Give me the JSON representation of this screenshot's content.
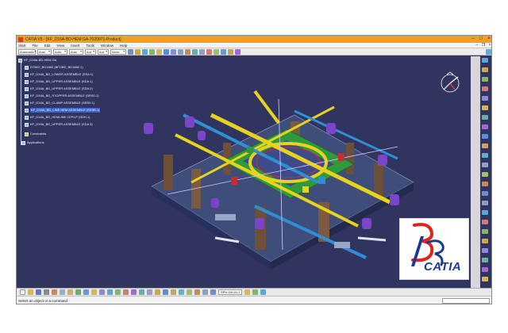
{
  "window": {
    "title": "CATIA V5 - [KF_D16A-BD-HEM GA-7020971-Product]",
    "icon": "catia-app-icon",
    "controls": [
      "–",
      "□",
      "×"
    ]
  },
  "menubar": {
    "items": [
      "Start",
      "File",
      "Edit",
      "View",
      "Insert",
      "Tools",
      "Window",
      "Help"
    ]
  },
  "toolbar": {
    "combos": [
      {
        "value": "Automatic"
      },
      {
        "value": "Auto"
      },
      {
        "value": "Auto"
      },
      {
        "value": "Auto"
      },
      {
        "value": "Aut"
      },
      {
        "value": "Aut"
      },
      {
        "value": "None"
      }
    ]
  },
  "tree": {
    "nodes": [
      {
        "label": "KF_D16A-BD-HEM GA"
      },
      {
        "label": "DTB02_BD1882 (BFOBD_BD1882.1)"
      },
      {
        "label": "KF_D16A_BD_LOWER ASSEMBLE (SSA 1)"
      },
      {
        "label": "KF_D16A_BD_UPPER ASSEMBLE (SDA 1)"
      },
      {
        "label": "KF_D16A_BD_UPPER ASSEMBLE (SDA 2)"
      },
      {
        "label": "KF_D16A_BD_STOPPER ASSEMBLE (SRS0.1)"
      },
      {
        "label": "KF_D16A_BD_CLAMP ASSEMBLE (SRS0.1)"
      },
      {
        "label": "KF_D16A_BD_LINE HEM ASSEMBLE (SSSB.1)"
      },
      {
        "label": "KF_D16A_BD_HEMLINE CEP.LP (SDH.1)"
      },
      {
        "label": "KF_D16A_BD_UPPER ASSEMBLE (SDA 3)"
      },
      {
        "label": "Constraints"
      },
      {
        "label": "Applications"
      }
    ],
    "selected_index": 7
  },
  "bottombar": {
    "combo_value": "SPH-GH.01.2"
  },
  "statusbar": {
    "text": "Select an object or a command"
  },
  "logo": {
    "wordmark": "CATIA",
    "brand_colors": {
      "red": "#e2231a",
      "blue": "#1b3b8f"
    }
  },
  "colors": {
    "viewport_bg": "#31345f",
    "title_bar": "#f0a21c",
    "selection": "#3b62c9",
    "model_yellow": "#e7d21e",
    "model_blue": "#2f8fd6",
    "model_green": "#2e9a3b",
    "model_purple": "#7a45c9",
    "model_red": "#c62e2e",
    "model_brown": "#6e5038"
  }
}
